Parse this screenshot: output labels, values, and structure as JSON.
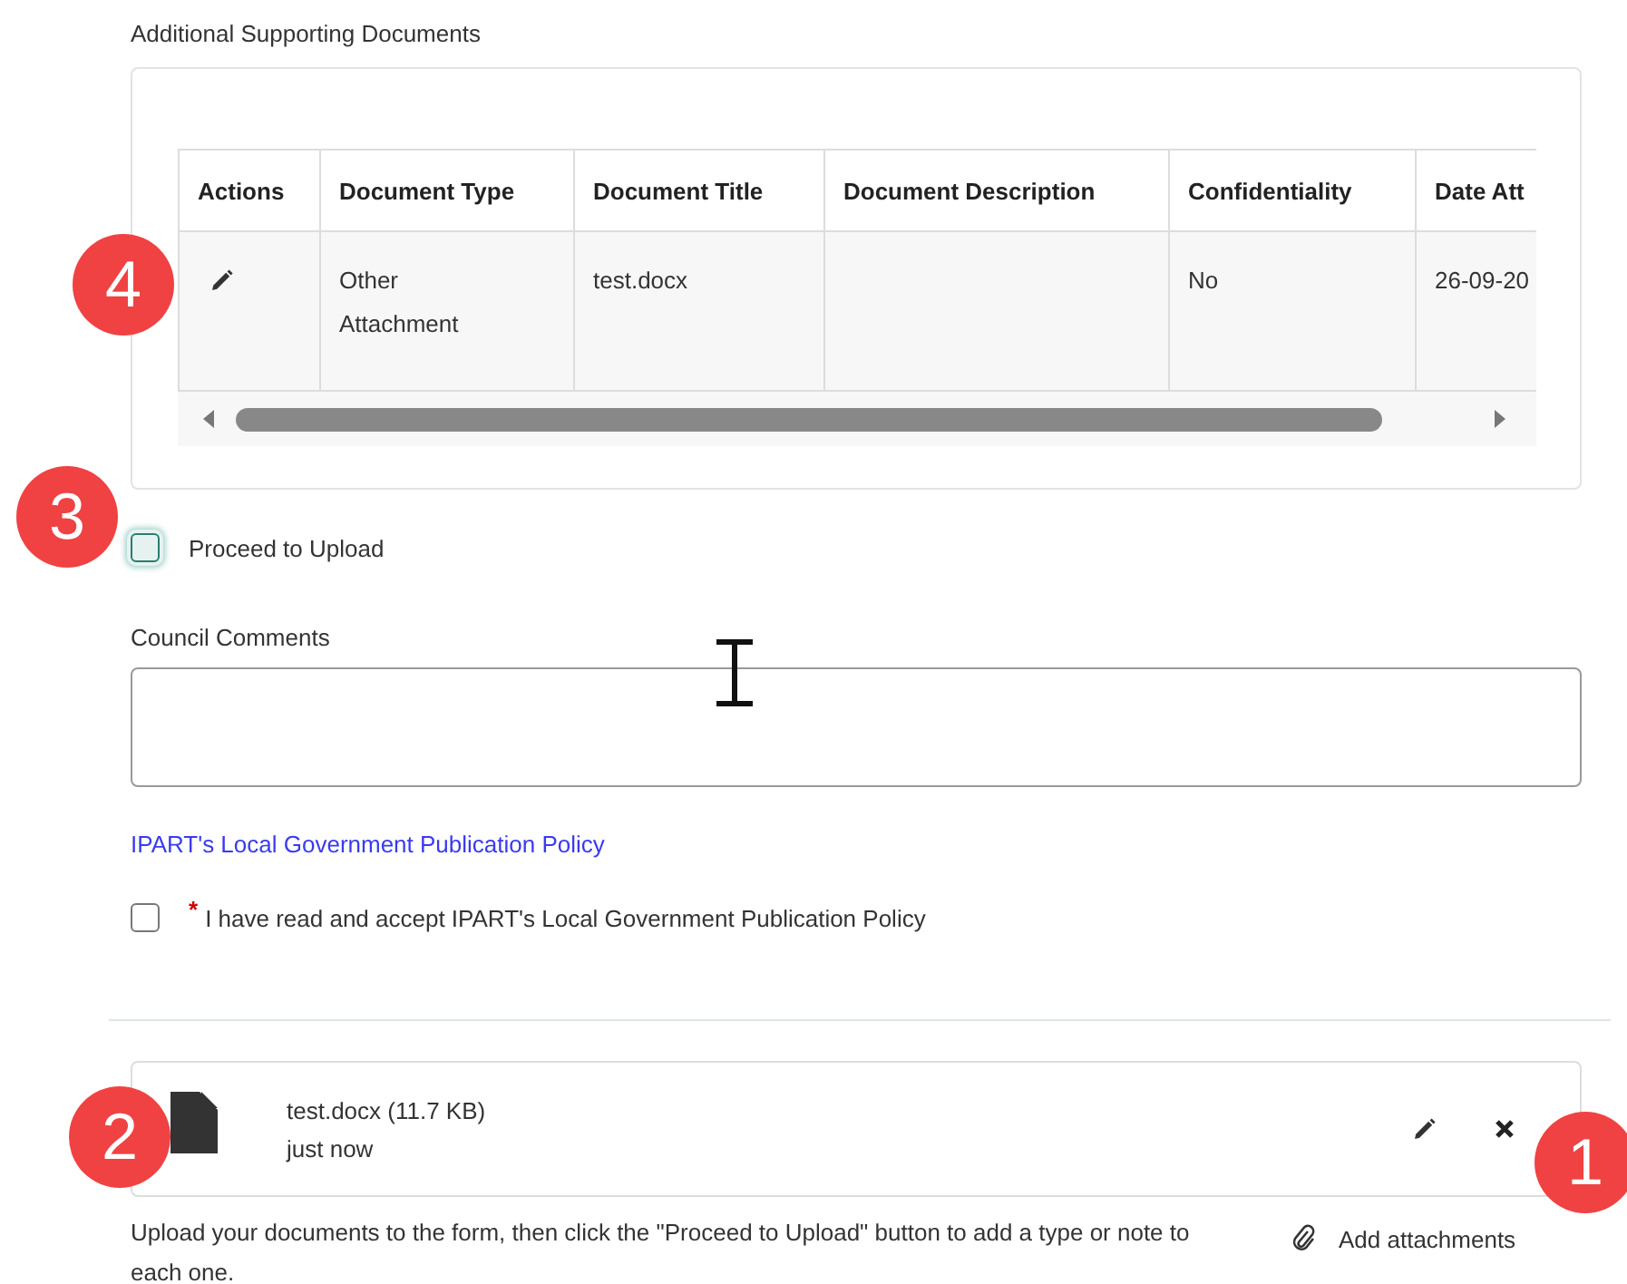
{
  "section_title": "Additional Supporting Documents",
  "table": {
    "columns": [
      "Actions",
      "Document Type",
      "Document Title",
      "Document Description",
      "Confidentiality",
      "Date Att"
    ],
    "rows": [
      {
        "type": "Other Attachment",
        "title": "test.docx",
        "confidentiality": "No",
        "date": "26-09-20"
      }
    ]
  },
  "proceed": {
    "label": "Proceed to Upload",
    "checked": false,
    "focused": true
  },
  "comments": {
    "label": "Council Comments"
  },
  "policy_link": "IPART's Local Government Publication Policy",
  "accept": {
    "required_mark": "*",
    "label": "I have read and accept IPART's Local Government Publication Policy",
    "checked": false
  },
  "files": [
    {
      "name": "test.docx (11.7 KB)",
      "time": "just now"
    }
  ],
  "help_text": "Upload your documents to the form, then click the \"Proceed to Upload\" button to add a type or note to each one.",
  "add_attachments": "Add attachments",
  "markers": [
    {
      "number": "4"
    },
    {
      "number": "3"
    },
    {
      "number": "2"
    },
    {
      "number": "1"
    }
  ]
}
